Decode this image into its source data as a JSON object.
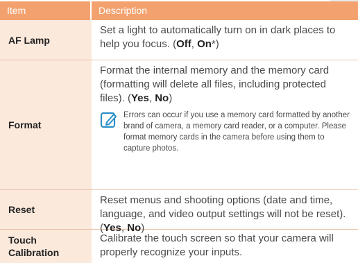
{
  "table": {
    "headers": {
      "item": "Item",
      "description": "Description"
    },
    "rows": [
      {
        "item": "AF Lamp",
        "desc_text": "Set a light to automatically turn on in dark places to help you focus. (",
        "opt1": "Off",
        "sep": ", ",
        "opt2": "On",
        "tail": "*)"
      },
      {
        "item": "Format",
        "desc_text": "Format the internal memory and the memory card (formatting will delete all files, including protected files). (",
        "opt1": "Yes",
        "sep": ", ",
        "opt2": "No",
        "tail": ")",
        "note": "Errors can occur if you use a memory card formatted by another brand of camera, a memory card reader, or a computer. Please format memory cards in the camera before using them to capture photos."
      },
      {
        "item": "Reset",
        "desc_text": "Reset menus and shooting options (date and time, language, and video output settings will not be reset). (",
        "opt1": "Yes",
        "sep": ", ",
        "opt2": "No",
        "tail": ")"
      },
      {
        "item_line1": "Touch",
        "item_line2": "Calibration",
        "desc_text": "Calibrate the touch screen so that your camera will properly recognize your inputs."
      }
    ]
  },
  "note_icon": "note-pencil-icon",
  "colors": {
    "header_bg": "#f3a26f",
    "item_bg": "#fbe9dc",
    "note_icon": "#2a8fc7"
  }
}
